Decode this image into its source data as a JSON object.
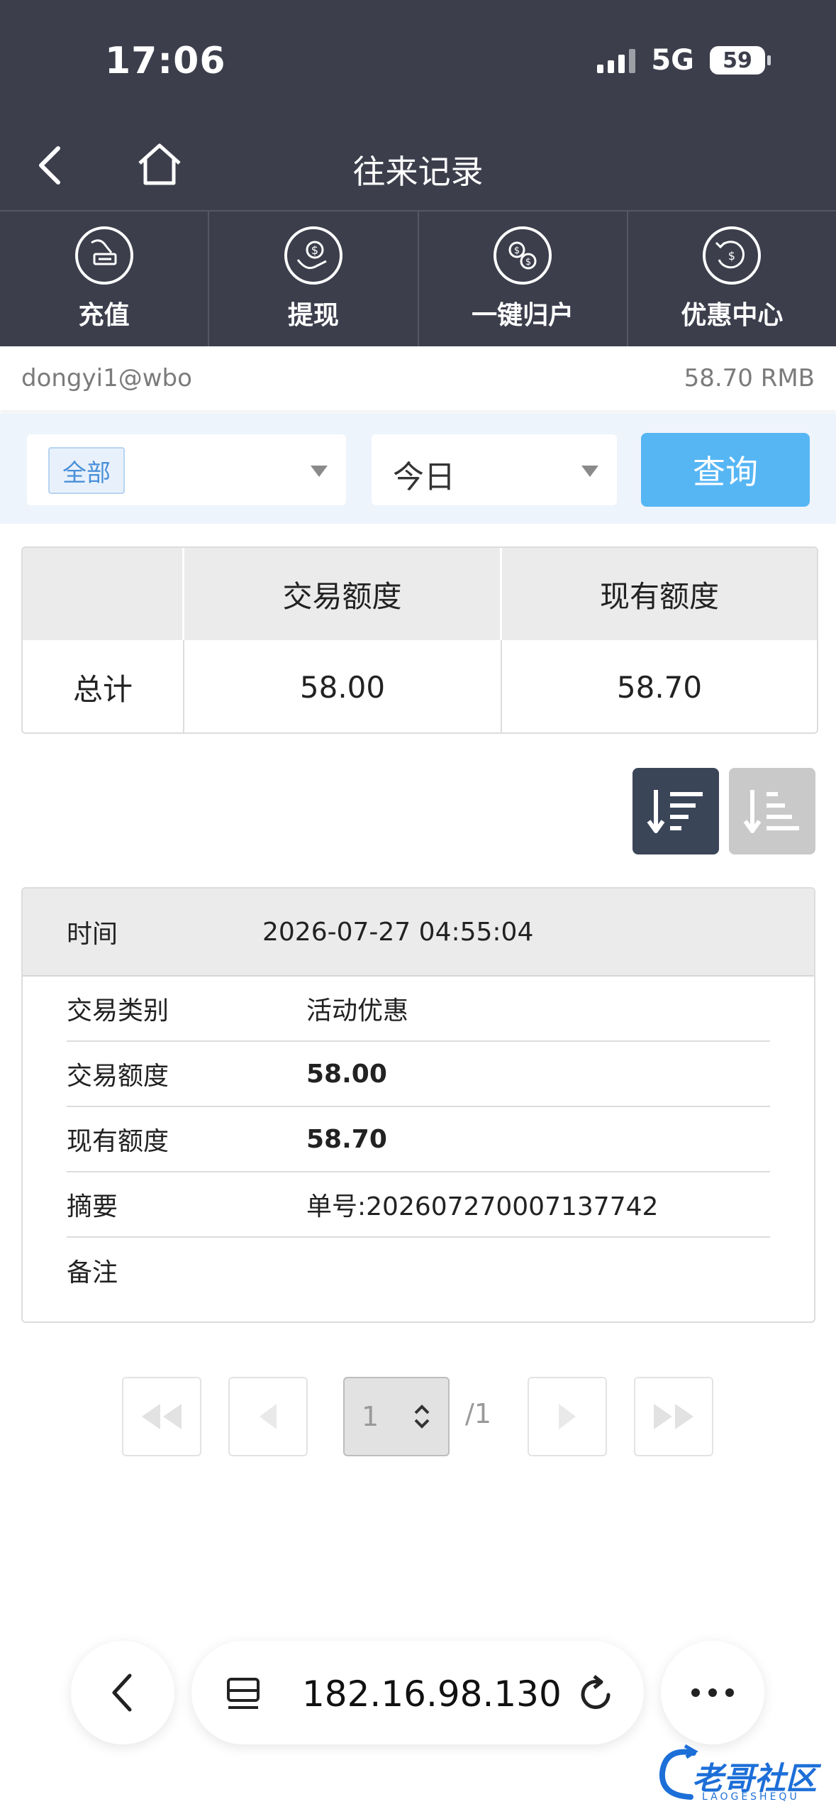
{
  "status": {
    "time": "17:06",
    "network": "5G",
    "battery": "59"
  },
  "nav": {
    "title": "往来记录"
  },
  "quick_actions": [
    {
      "label": "充值",
      "icon": "recharge-icon"
    },
    {
      "label": "提现",
      "icon": "withdraw-icon"
    },
    {
      "label": "一键归户",
      "icon": "transfer-back-icon"
    },
    {
      "label": "优惠中心",
      "icon": "promo-center-icon"
    }
  ],
  "account": {
    "username": "dongyi1@wbo",
    "balance": "58.70 RMB"
  },
  "filters": {
    "type_selected": "全部",
    "date_selected": "今日",
    "query_label": "查询"
  },
  "summary": {
    "headers": [
      "",
      "交易额度",
      "现有额度"
    ],
    "rows": [
      [
        "总计",
        "58.00",
        "58.70"
      ]
    ]
  },
  "record": {
    "time_label": "时间",
    "time_value": "2026-07-27 04:55:04",
    "rows": [
      {
        "label": "交易类别",
        "value": "活动优惠"
      },
      {
        "label": "交易额度",
        "value": "58.00"
      },
      {
        "label": "现有额度",
        "value": "58.70"
      },
      {
        "label": "摘要",
        "value": "单号:202607270007137742"
      },
      {
        "label": "备注",
        "value": ""
      }
    ]
  },
  "pager": {
    "current": "1",
    "total": "/1"
  },
  "browser": {
    "url": "182.16.98.130"
  },
  "watermark": {
    "text": "老哥社区",
    "sub": "LAOGESHEQU"
  },
  "colors": {
    "header": "#3c3e4c",
    "query_button": "#56b6f4",
    "sort_active": "#3a4558",
    "sort_inactive": "#c9c9c9"
  }
}
